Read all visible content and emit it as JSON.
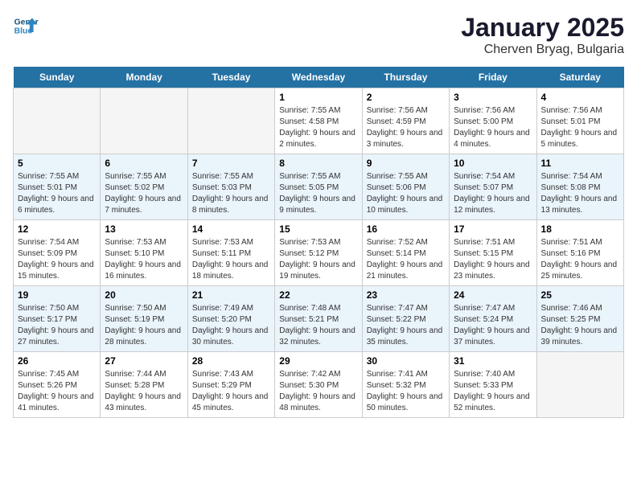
{
  "header": {
    "logo_line1": "General",
    "logo_line2": "Blue",
    "month": "January 2025",
    "location": "Cherven Bryag, Bulgaria"
  },
  "days_of_week": [
    "Sunday",
    "Monday",
    "Tuesday",
    "Wednesday",
    "Thursday",
    "Friday",
    "Saturday"
  ],
  "weeks": [
    [
      {
        "day": "",
        "sunrise": "",
        "sunset": "",
        "daylight": ""
      },
      {
        "day": "",
        "sunrise": "",
        "sunset": "",
        "daylight": ""
      },
      {
        "day": "",
        "sunrise": "",
        "sunset": "",
        "daylight": ""
      },
      {
        "day": "1",
        "sunrise": "Sunrise: 7:55 AM",
        "sunset": "Sunset: 4:58 PM",
        "daylight": "Daylight: 9 hours and 2 minutes."
      },
      {
        "day": "2",
        "sunrise": "Sunrise: 7:56 AM",
        "sunset": "Sunset: 4:59 PM",
        "daylight": "Daylight: 9 hours and 3 minutes."
      },
      {
        "day": "3",
        "sunrise": "Sunrise: 7:56 AM",
        "sunset": "Sunset: 5:00 PM",
        "daylight": "Daylight: 9 hours and 4 minutes."
      },
      {
        "day": "4",
        "sunrise": "Sunrise: 7:56 AM",
        "sunset": "Sunset: 5:01 PM",
        "daylight": "Daylight: 9 hours and 5 minutes."
      }
    ],
    [
      {
        "day": "5",
        "sunrise": "Sunrise: 7:55 AM",
        "sunset": "Sunset: 5:01 PM",
        "daylight": "Daylight: 9 hours and 6 minutes."
      },
      {
        "day": "6",
        "sunrise": "Sunrise: 7:55 AM",
        "sunset": "Sunset: 5:02 PM",
        "daylight": "Daylight: 9 hours and 7 minutes."
      },
      {
        "day": "7",
        "sunrise": "Sunrise: 7:55 AM",
        "sunset": "Sunset: 5:03 PM",
        "daylight": "Daylight: 9 hours and 8 minutes."
      },
      {
        "day": "8",
        "sunrise": "Sunrise: 7:55 AM",
        "sunset": "Sunset: 5:05 PM",
        "daylight": "Daylight: 9 hours and 9 minutes."
      },
      {
        "day": "9",
        "sunrise": "Sunrise: 7:55 AM",
        "sunset": "Sunset: 5:06 PM",
        "daylight": "Daylight: 9 hours and 10 minutes."
      },
      {
        "day": "10",
        "sunrise": "Sunrise: 7:54 AM",
        "sunset": "Sunset: 5:07 PM",
        "daylight": "Daylight: 9 hours and 12 minutes."
      },
      {
        "day": "11",
        "sunrise": "Sunrise: 7:54 AM",
        "sunset": "Sunset: 5:08 PM",
        "daylight": "Daylight: 9 hours and 13 minutes."
      }
    ],
    [
      {
        "day": "12",
        "sunrise": "Sunrise: 7:54 AM",
        "sunset": "Sunset: 5:09 PM",
        "daylight": "Daylight: 9 hours and 15 minutes."
      },
      {
        "day": "13",
        "sunrise": "Sunrise: 7:53 AM",
        "sunset": "Sunset: 5:10 PM",
        "daylight": "Daylight: 9 hours and 16 minutes."
      },
      {
        "day": "14",
        "sunrise": "Sunrise: 7:53 AM",
        "sunset": "Sunset: 5:11 PM",
        "daylight": "Daylight: 9 hours and 18 minutes."
      },
      {
        "day": "15",
        "sunrise": "Sunrise: 7:53 AM",
        "sunset": "Sunset: 5:12 PM",
        "daylight": "Daylight: 9 hours and 19 minutes."
      },
      {
        "day": "16",
        "sunrise": "Sunrise: 7:52 AM",
        "sunset": "Sunset: 5:14 PM",
        "daylight": "Daylight: 9 hours and 21 minutes."
      },
      {
        "day": "17",
        "sunrise": "Sunrise: 7:51 AM",
        "sunset": "Sunset: 5:15 PM",
        "daylight": "Daylight: 9 hours and 23 minutes."
      },
      {
        "day": "18",
        "sunrise": "Sunrise: 7:51 AM",
        "sunset": "Sunset: 5:16 PM",
        "daylight": "Daylight: 9 hours and 25 minutes."
      }
    ],
    [
      {
        "day": "19",
        "sunrise": "Sunrise: 7:50 AM",
        "sunset": "Sunset: 5:17 PM",
        "daylight": "Daylight: 9 hours and 27 minutes."
      },
      {
        "day": "20",
        "sunrise": "Sunrise: 7:50 AM",
        "sunset": "Sunset: 5:19 PM",
        "daylight": "Daylight: 9 hours and 28 minutes."
      },
      {
        "day": "21",
        "sunrise": "Sunrise: 7:49 AM",
        "sunset": "Sunset: 5:20 PM",
        "daylight": "Daylight: 9 hours and 30 minutes."
      },
      {
        "day": "22",
        "sunrise": "Sunrise: 7:48 AM",
        "sunset": "Sunset: 5:21 PM",
        "daylight": "Daylight: 9 hours and 32 minutes."
      },
      {
        "day": "23",
        "sunrise": "Sunrise: 7:47 AM",
        "sunset": "Sunset: 5:22 PM",
        "daylight": "Daylight: 9 hours and 35 minutes."
      },
      {
        "day": "24",
        "sunrise": "Sunrise: 7:47 AM",
        "sunset": "Sunset: 5:24 PM",
        "daylight": "Daylight: 9 hours and 37 minutes."
      },
      {
        "day": "25",
        "sunrise": "Sunrise: 7:46 AM",
        "sunset": "Sunset: 5:25 PM",
        "daylight": "Daylight: 9 hours and 39 minutes."
      }
    ],
    [
      {
        "day": "26",
        "sunrise": "Sunrise: 7:45 AM",
        "sunset": "Sunset: 5:26 PM",
        "daylight": "Daylight: 9 hours and 41 minutes."
      },
      {
        "day": "27",
        "sunrise": "Sunrise: 7:44 AM",
        "sunset": "Sunset: 5:28 PM",
        "daylight": "Daylight: 9 hours and 43 minutes."
      },
      {
        "day": "28",
        "sunrise": "Sunrise: 7:43 AM",
        "sunset": "Sunset: 5:29 PM",
        "daylight": "Daylight: 9 hours and 45 minutes."
      },
      {
        "day": "29",
        "sunrise": "Sunrise: 7:42 AM",
        "sunset": "Sunset: 5:30 PM",
        "daylight": "Daylight: 9 hours and 48 minutes."
      },
      {
        "day": "30",
        "sunrise": "Sunrise: 7:41 AM",
        "sunset": "Sunset: 5:32 PM",
        "daylight": "Daylight: 9 hours and 50 minutes."
      },
      {
        "day": "31",
        "sunrise": "Sunrise: 7:40 AM",
        "sunset": "Sunset: 5:33 PM",
        "daylight": "Daylight: 9 hours and 52 minutes."
      },
      {
        "day": "",
        "sunrise": "",
        "sunset": "",
        "daylight": ""
      }
    ]
  ]
}
